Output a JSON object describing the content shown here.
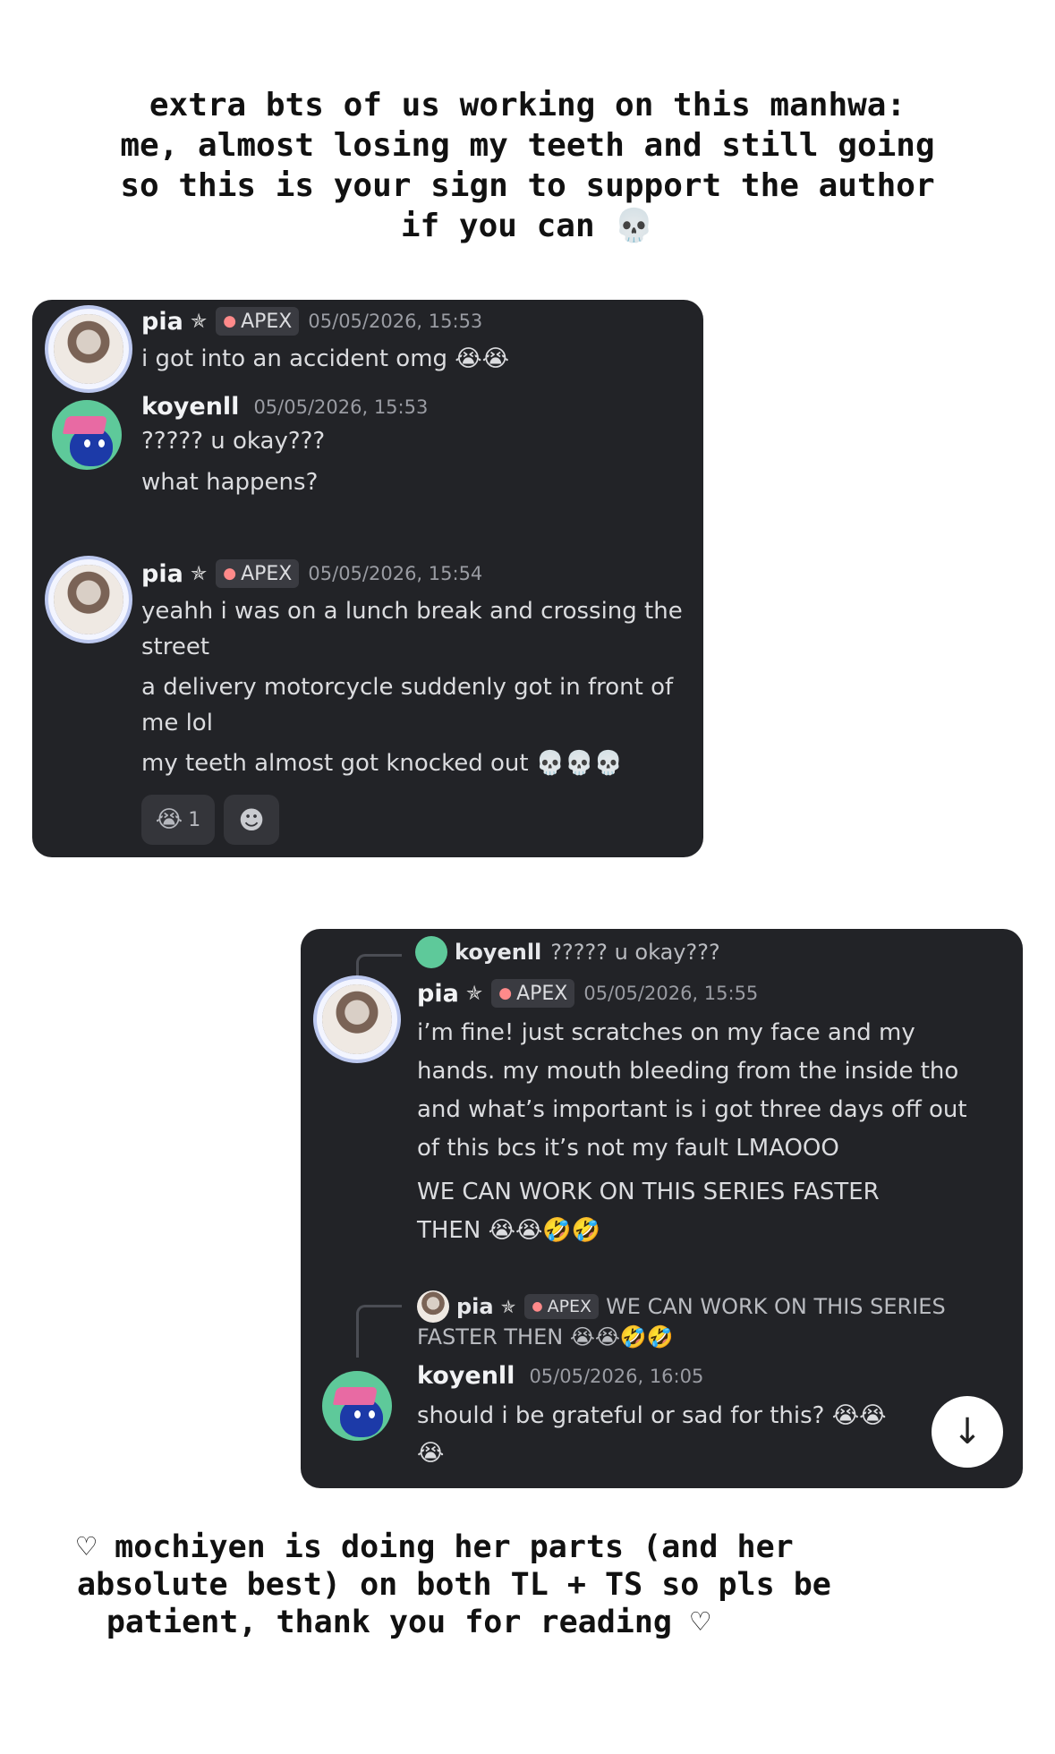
{
  "top_caption": [
    "extra bts of us working on this manhwa:",
    "me, almost losing my teeth and still going",
    "so this is your sign to support the author",
    "if you can 💀"
  ],
  "panel_1": {
    "messages": [
      {
        "author": "pia",
        "star": "✯",
        "tag": "APEX",
        "timestamp": "05/05/2026, 15:53",
        "lines": [
          "i got into an accident omg 😭😭"
        ]
      },
      {
        "author": "koyenll",
        "timestamp": "05/05/2026, 15:53",
        "lines": [
          "????? u okay???",
          "what happens?"
        ]
      },
      {
        "author": "pia",
        "star": "✯",
        "tag": "APEX",
        "timestamp": "05/05/2026, 15:54",
        "lines": [
          "yeahh i was on a lunch break and crossing the",
          "street",
          "a delivery motorcycle suddenly got in front of",
          "me lol",
          "my teeth almost got knocked out 💀💀💀"
        ]
      }
    ],
    "reactions": [
      {
        "emoji": "😭",
        "count": "1"
      },
      {
        "emoji": "☻",
        "count": ""
      }
    ]
  },
  "panel_2": {
    "reply_1": {
      "author": "koyenll",
      "text": "????? u okay???"
    },
    "message_1": {
      "author": "pia",
      "star": "✯",
      "tag": "APEX",
      "timestamp": "05/05/2026, 15:55",
      "lines": [
        "i’m fine! just scratches on my face and my",
        "hands. my mouth bleeding from the inside tho",
        "and what’s important is i got three days off out",
        "of this bcs it’s not my fault LMAOOO",
        "WE CAN WORK ON THIS SERIES FASTER",
        "THEN 😭😭🤣🤣"
      ]
    },
    "reply_2": {
      "author": "pia",
      "star": "✯",
      "tag": "APEX",
      "text_line1": "WE CAN WORK ON THIS SERIES",
      "text_line2": "FASTER THEN 😭😭🤣🤣"
    },
    "message_2": {
      "author": "koyenll",
      "timestamp": "05/05/2026, 16:05",
      "lines": [
        "should i be grateful or sad for this? 😭😭",
        "😭"
      ]
    },
    "scroll_button": "↓"
  },
  "bottom_caption": [
    "♡ mochiyen is doing her parts (and her",
    "absolute best) on both TL + TS so pls be",
    "patient, thank you for reading ♡"
  ],
  "colors": {
    "panel_bg": "#222327",
    "name": "#f2f3f5",
    "text": "#dbdcdf",
    "timestamp": "#9a9ca3",
    "tag_bg": "#3a3b41",
    "koyenll_avatar_bg": "#5ec99a"
  }
}
